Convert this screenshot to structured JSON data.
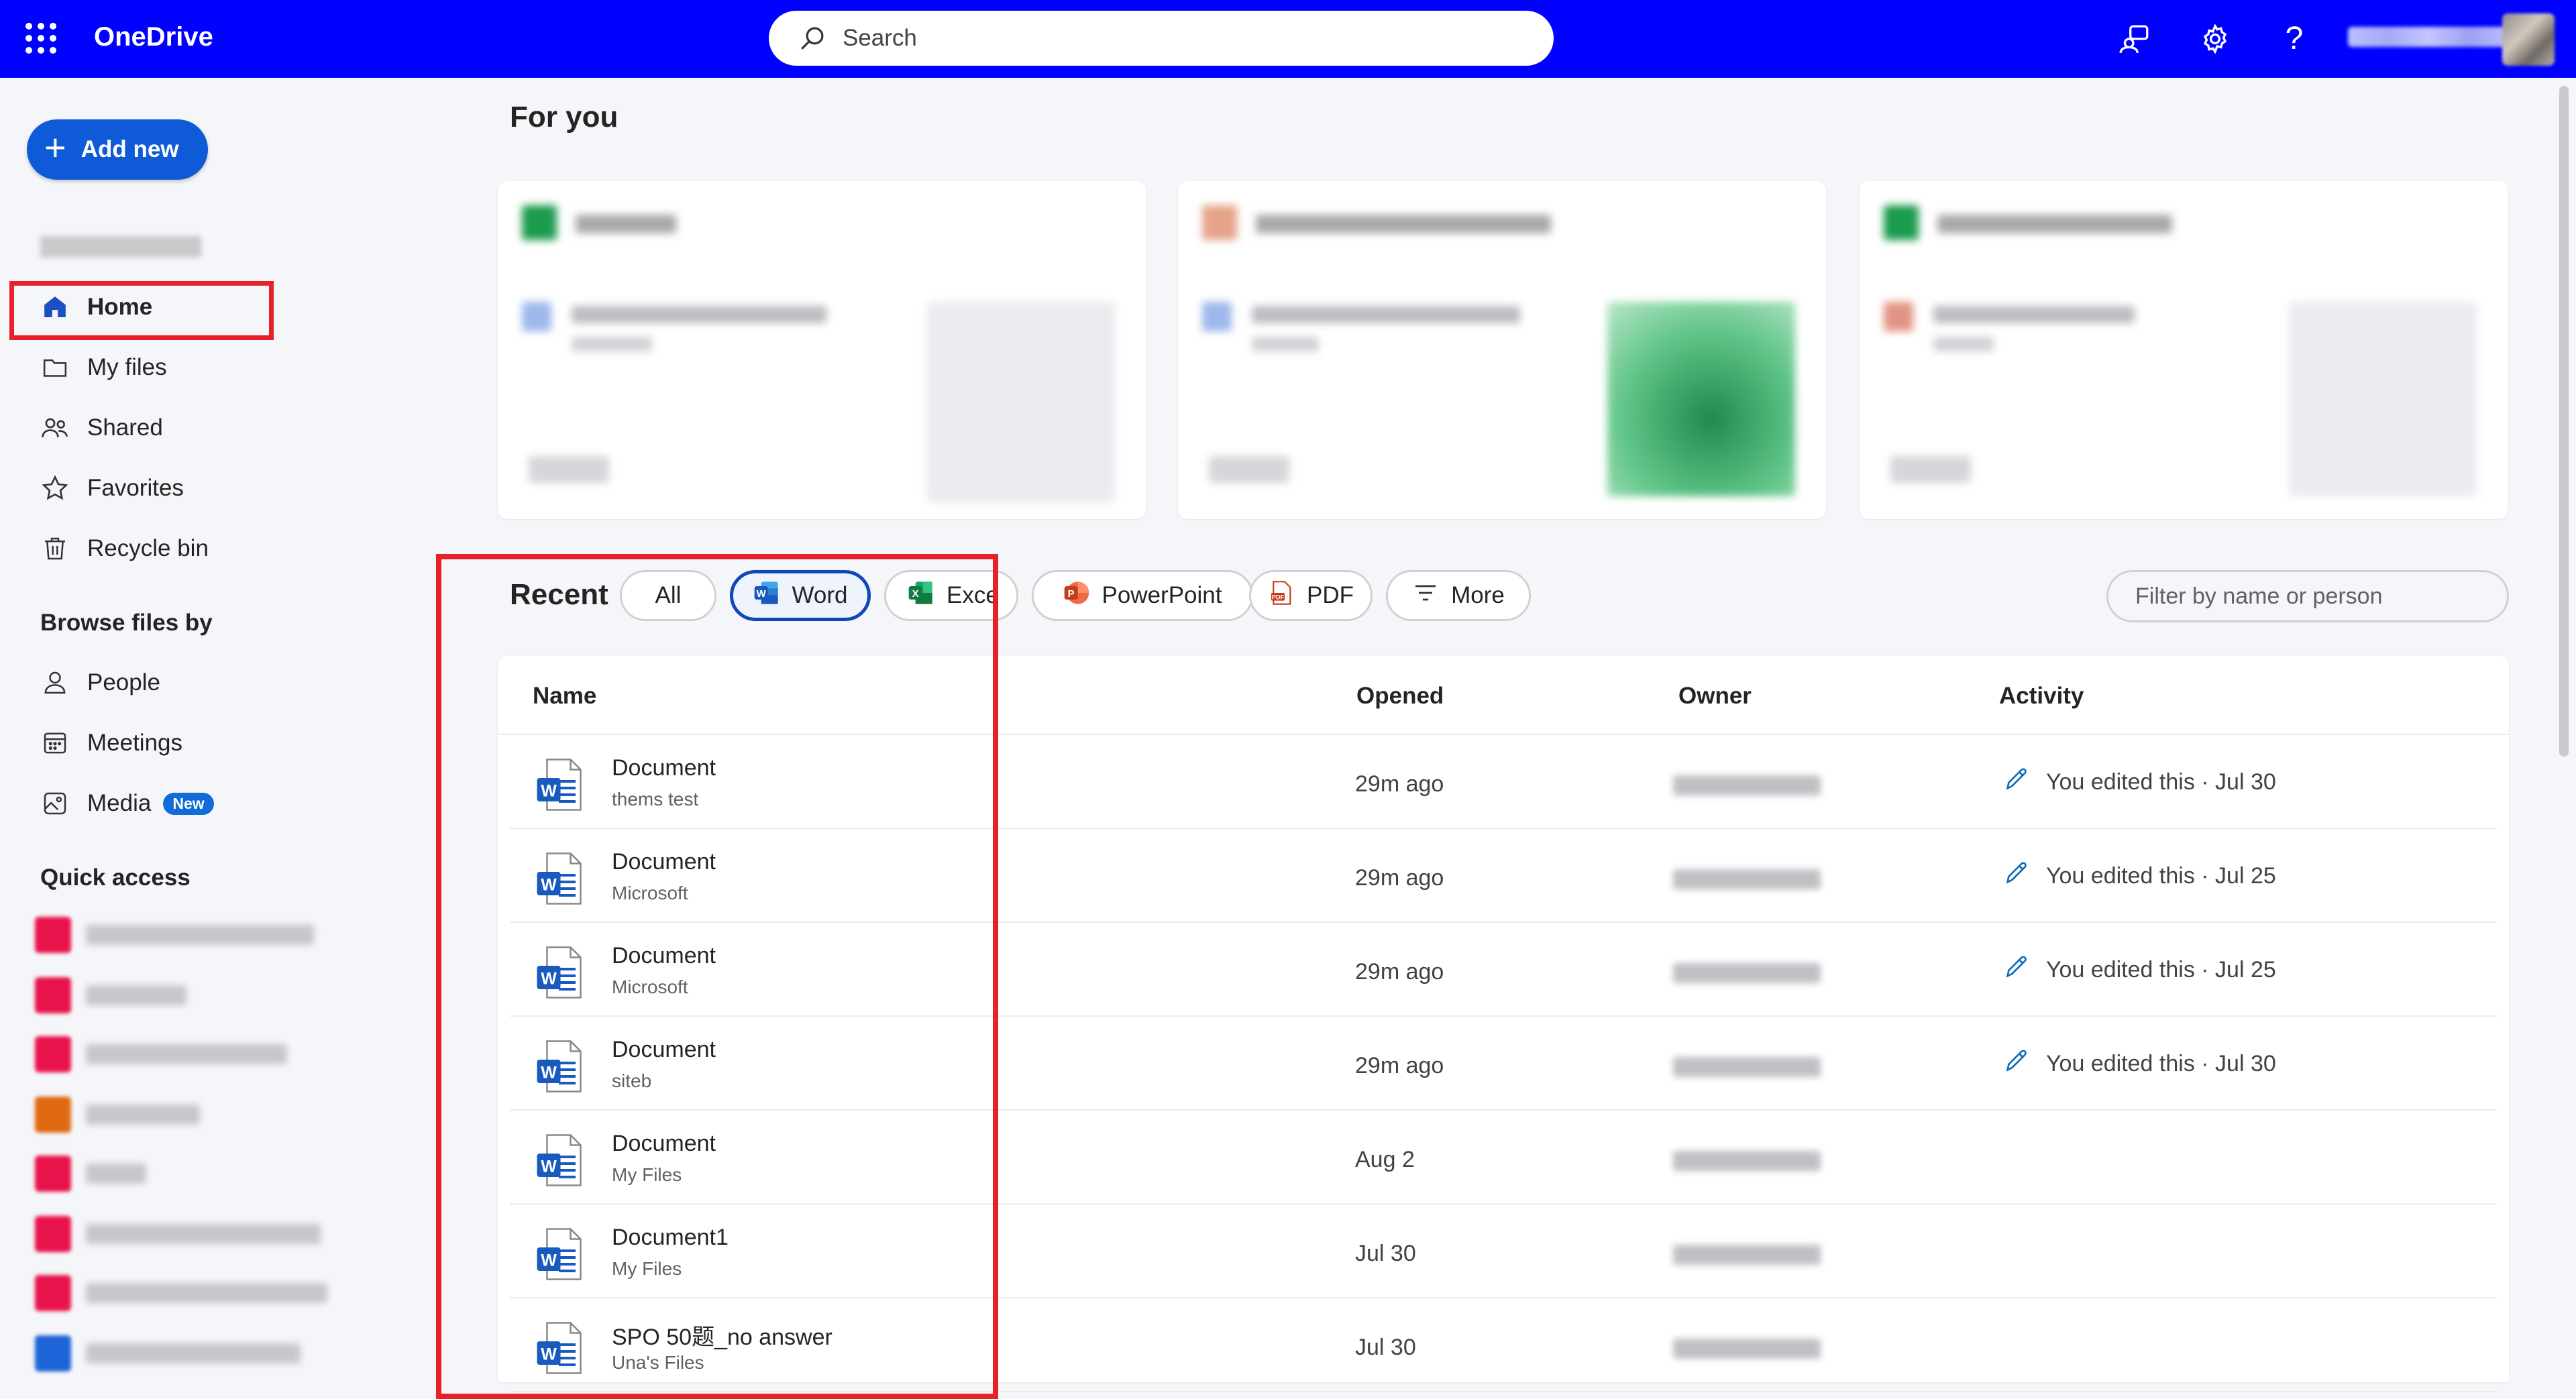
{
  "app": {
    "brand": "OneDrive"
  },
  "search": {
    "placeholder": "Search"
  },
  "topbar": {
    "icons": [
      "feedback-icon",
      "gear-icon",
      "help-icon"
    ]
  },
  "sidebar": {
    "add_new_label": "Add new",
    "nav": [
      {
        "label": "Home",
        "icon": "home-icon",
        "active": true
      },
      {
        "label": "My files",
        "icon": "folder-icon"
      },
      {
        "label": "Shared",
        "icon": "people-icon"
      },
      {
        "label": "Favorites",
        "icon": "star-icon"
      },
      {
        "label": "Recycle bin",
        "icon": "trash-icon"
      }
    ],
    "browse_title": "Browse files by",
    "browse": [
      {
        "label": "People",
        "icon": "person-icon"
      },
      {
        "label": "Meetings",
        "icon": "calendar-icon"
      },
      {
        "label": "Media",
        "icon": "image-icon",
        "badge": "New"
      }
    ],
    "quick_access_title": "Quick access"
  },
  "main": {
    "for_you_title": "For you",
    "recent_title": "Recent",
    "filters": [
      {
        "label": "All"
      },
      {
        "label": "Word",
        "selected": true
      },
      {
        "label": "Exce"
      },
      {
        "label": "PowerPoint"
      },
      {
        "label": "PDF"
      },
      {
        "label": "More"
      }
    ],
    "filter_placeholder": "Filter by name or person",
    "columns": {
      "name": "Name",
      "opened": "Opened",
      "owner": "Owner",
      "activity": "Activity"
    },
    "rows": [
      {
        "name": "Document",
        "location": "thems test",
        "opened": "29m ago",
        "activity": "You edited this · Jul 30"
      },
      {
        "name": "Document",
        "location": "Microsoft",
        "opened": "29m ago",
        "activity": "You edited this · Jul 25"
      },
      {
        "name": "Document",
        "location": "Microsoft",
        "opened": "29m ago",
        "activity": "You edited this · Jul 25"
      },
      {
        "name": "Document",
        "location": "siteb",
        "opened": "29m ago",
        "activity": "You edited this · Jul 30"
      },
      {
        "name": "Document",
        "location": "My Files",
        "opened": "Aug 2",
        "activity": ""
      },
      {
        "name": "Document1",
        "location": "My Files",
        "opened": "Jul 30",
        "activity": ""
      },
      {
        "name": "SPO 50题_no answer",
        "location": "Una's Files",
        "opened": "Jul 30",
        "activity": ""
      }
    ]
  },
  "colors": {
    "topbar": "#0000ff",
    "accent": "#0f5bd7",
    "highlight": "#e8202a",
    "word": "#185abd",
    "excel": "#107c41",
    "powerpoint": "#c43e1c"
  }
}
